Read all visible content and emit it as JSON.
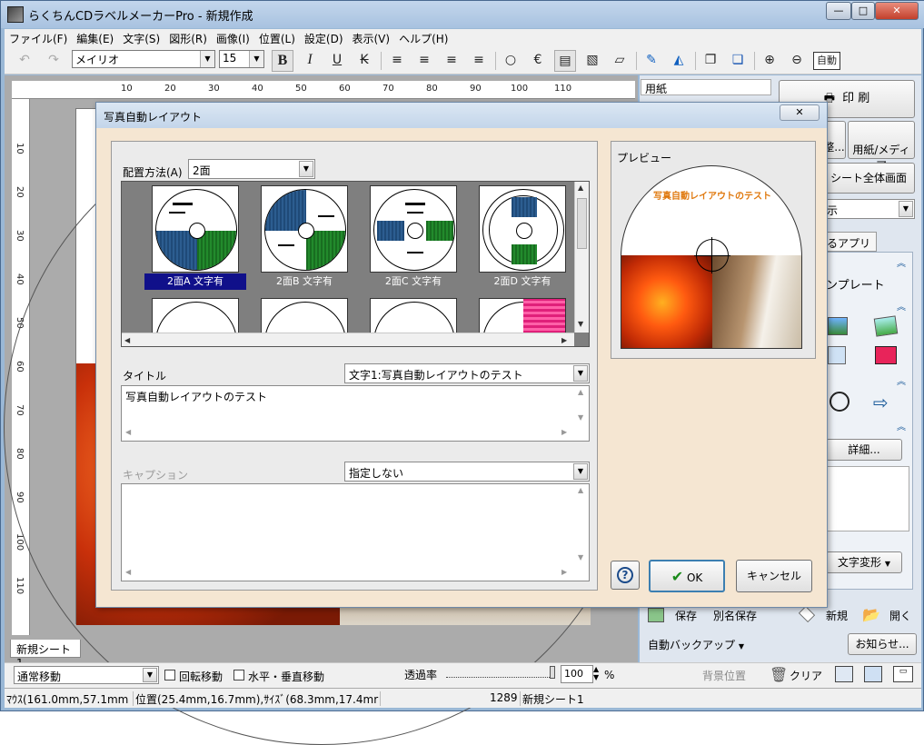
{
  "window": {
    "title": "らくちんCDラベルメーカーPro - 新規作成",
    "min": "—",
    "max": "□",
    "close": "✕"
  },
  "menu": [
    "ファイル(F)",
    "編集(E)",
    "文字(S)",
    "図形(R)",
    "画像(I)",
    "位置(L)",
    "設定(D)",
    "表示(V)",
    "ヘルプ(H)"
  ],
  "toolbar": {
    "font_name": "メイリオ",
    "font_size": "15",
    "bold": "B",
    "italic": "I",
    "underline": "U",
    "strike": "K",
    "auto": "自動"
  },
  "ruler": {
    "h_ticks": [
      "10",
      "20",
      "30",
      "40",
      "50",
      "60",
      "70",
      "80",
      "90",
      "100",
      "110"
    ],
    "v_ticks": [
      "10",
      "20",
      "30",
      "40",
      "50",
      "60",
      "70",
      "80",
      "90",
      "100",
      "110"
    ]
  },
  "sheet_tab": "新規シート1",
  "right_panel": {
    "paper_label": "用紙",
    "print_btn": "印 刷",
    "adjust_partial": "整...",
    "paper_media_btn": "用紙/メディア",
    "sheet_full_btn": "シート全体画面",
    "display_combo": "示",
    "apps_tab": "るアプリ",
    "template_label": "ンプレート",
    "details_btn": "詳細...",
    "text_transform_btn": "文字変形",
    "save_btn": "保存",
    "save_as_btn": "別名保存",
    "new_btn": "新規",
    "open_btn": "開く",
    "auto_backup": "自動バックアップ",
    "notice_btn": "お知らせ..."
  },
  "bottom_bar": {
    "move_mode": "通常移動",
    "rotate_move": "回転移動",
    "hv_move": "水平・垂直移動",
    "opacity_label": "透過率",
    "opacity_value": "100",
    "opacity_unit": "%",
    "bg_position": "背景位置",
    "clear": "クリア"
  },
  "status": {
    "mouse": "ﾏｳｽ(161.0mm,57.1mm",
    "position": "位置(25.4mm,16.7mm),ｻｲｽﾞ(68.3mm,17.4mr",
    "code": "1289",
    "sheet": "新規シート1"
  },
  "dialog": {
    "title": "写真自動レイアウト",
    "close": "✕",
    "layout_label": "配置方法(A)",
    "layout_value": "2面",
    "thumbnails": [
      "2面A 文字有",
      "2面B 文字有",
      "2面C 文字有",
      "2面D 文字有"
    ],
    "selected_thumbnail": 0,
    "title_label": "タイトル",
    "title_source": "文字1:写真自動レイアウトのテスト",
    "title_text": "写真自動レイアウトのテスト",
    "caption_label": "キャプション",
    "caption_source": "指定しない",
    "caption_text": "",
    "preview_label": "プレビュー",
    "preview_title": "写真自動レイアウトのテスト",
    "help_btn": "?",
    "ok_btn": "OK",
    "cancel_btn": "キャンセル"
  },
  "colors": {
    "accent_blue": "#1f4a78",
    "accent_green": "#228a2c",
    "selected_caption": "#10108a",
    "dialog_bg": "#f5e6d2",
    "preview_title_color": "#e07a10"
  }
}
